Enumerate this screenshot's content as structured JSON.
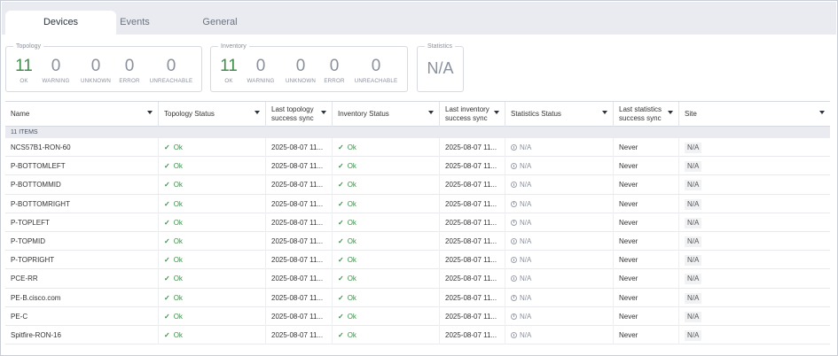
{
  "tabs": [
    {
      "label": "Devices",
      "active": true
    },
    {
      "label": "Events",
      "active": false
    },
    {
      "label": "General",
      "active": false
    }
  ],
  "summary": {
    "topology": {
      "title": "Topology",
      "stats": [
        {
          "value": "11",
          "label": "OK"
        },
        {
          "value": "0",
          "label": "WARNING"
        },
        {
          "value": "0",
          "label": "UNKNOWN"
        },
        {
          "value": "0",
          "label": "ERROR"
        },
        {
          "value": "0",
          "label": "UNREACHABLE"
        }
      ]
    },
    "inventory": {
      "title": "Inventory",
      "stats": [
        {
          "value": "11",
          "label": "OK"
        },
        {
          "value": "0",
          "label": "WARNING"
        },
        {
          "value": "0",
          "label": "UNKNOWN"
        },
        {
          "value": "0",
          "label": "ERROR"
        },
        {
          "value": "0",
          "label": "UNREACHABLE"
        }
      ]
    },
    "statistics": {
      "title": "Statistics",
      "value": "N/A"
    }
  },
  "table": {
    "columns": [
      {
        "label": "Name"
      },
      {
        "label": "Topology Status"
      },
      {
        "label": "Last topology success sync"
      },
      {
        "label": "Inventory Status"
      },
      {
        "label": "Last inventory success sync"
      },
      {
        "label": "Statistics Status"
      },
      {
        "label": "Last statistics success sync"
      },
      {
        "label": "Site"
      }
    ],
    "items_count_label": "11 ITEMS",
    "rows": [
      {
        "name": "NCS57B1-RON-60",
        "topology_status": "Ok",
        "topology_sync": "2025-08-07 11...",
        "inventory_status": "Ok",
        "inventory_sync": "2025-08-07 11...",
        "statistics_status": "N/A",
        "statistics_sync": "Never",
        "site": "N/A"
      },
      {
        "name": "P-BOTTOMLEFT",
        "topology_status": "Ok",
        "topology_sync": "2025-08-07 11...",
        "inventory_status": "Ok",
        "inventory_sync": "2025-08-07 11...",
        "statistics_status": "N/A",
        "statistics_sync": "Never",
        "site": "N/A"
      },
      {
        "name": "P-BOTTOMMID",
        "topology_status": "Ok",
        "topology_sync": "2025-08-07 11...",
        "inventory_status": "Ok",
        "inventory_sync": "2025-08-07 11...",
        "statistics_status": "N/A",
        "statistics_sync": "Never",
        "site": "N/A"
      },
      {
        "name": "P-BOTTOMRIGHT",
        "topology_status": "Ok",
        "topology_sync": "2025-08-07 11...",
        "inventory_status": "Ok",
        "inventory_sync": "2025-08-07 11...",
        "statistics_status": "N/A",
        "statistics_sync": "Never",
        "site": "N/A"
      },
      {
        "name": "P-TOPLEFT",
        "topology_status": "Ok",
        "topology_sync": "2025-08-07 11...",
        "inventory_status": "Ok",
        "inventory_sync": "2025-08-07 11...",
        "statistics_status": "N/A",
        "statistics_sync": "Never",
        "site": "N/A"
      },
      {
        "name": "P-TOPMID",
        "topology_status": "Ok",
        "topology_sync": "2025-08-07 11...",
        "inventory_status": "Ok",
        "inventory_sync": "2025-08-07 11...",
        "statistics_status": "N/A",
        "statistics_sync": "Never",
        "site": "N/A"
      },
      {
        "name": "P-TOPRIGHT",
        "topology_status": "Ok",
        "topology_sync": "2025-08-07 11...",
        "inventory_status": "Ok",
        "inventory_sync": "2025-08-07 11...",
        "statistics_status": "N/A",
        "statistics_sync": "Never",
        "site": "N/A"
      },
      {
        "name": "PCE-RR",
        "topology_status": "Ok",
        "topology_sync": "2025-08-07 11...",
        "inventory_status": "Ok",
        "inventory_sync": "2025-08-07 11...",
        "statistics_status": "N/A",
        "statistics_sync": "Never",
        "site": "N/A"
      },
      {
        "name": "PE-B.cisco.com",
        "topology_status": "Ok",
        "topology_sync": "2025-08-07 11...",
        "inventory_status": "Ok",
        "inventory_sync": "2025-08-07 11...",
        "statistics_status": "N/A",
        "statistics_sync": "Never",
        "site": "N/A"
      },
      {
        "name": "PE-C",
        "topology_status": "Ok",
        "topology_sync": "2025-08-07 11...",
        "inventory_status": "Ok",
        "inventory_sync": "2025-08-07 11...",
        "statistics_status": "N/A",
        "statistics_sync": "Never",
        "site": "N/A"
      },
      {
        "name": "Spitfire-RON-16",
        "topology_status": "Ok",
        "topology_sync": "2025-08-07 11...",
        "inventory_status": "Ok",
        "inventory_sync": "2025-08-07 11...",
        "statistics_status": "N/A",
        "statistics_sync": "Never",
        "site": "N/A"
      }
    ]
  },
  "icons": {
    "ok": "check-icon",
    "na": "info-circle-icon",
    "sort": "caret-down-icon"
  },
  "colors": {
    "ok": "#3f8f4a",
    "muted": "#8a919c",
    "tabbar_bg": "#e9ebf0"
  }
}
